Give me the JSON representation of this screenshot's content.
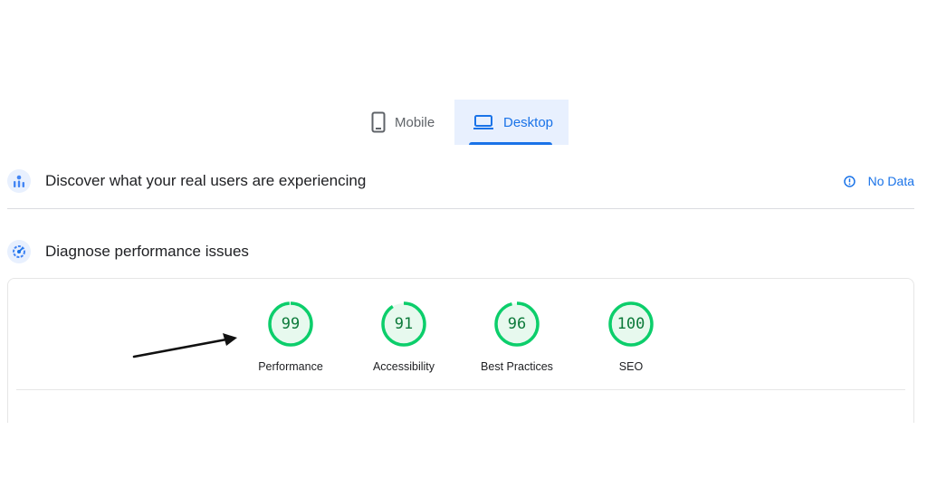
{
  "tabs": [
    {
      "label": "Mobile",
      "icon": "smartphone-icon",
      "selected": false
    },
    {
      "label": "Desktop",
      "icon": "laptop-icon",
      "selected": true
    }
  ],
  "crux": {
    "title": "Discover what your real users are experiencing",
    "status_label": "No Data",
    "status_icon": "info-icon"
  },
  "diagnose": {
    "title": "Diagnose performance issues"
  },
  "scores": [
    {
      "label": "Performance",
      "value": 99
    },
    {
      "label": "Accessibility",
      "value": 91
    },
    {
      "label": "Best Practices",
      "value": 96
    },
    {
      "label": "SEO",
      "value": 100
    }
  ],
  "colors": {
    "accent": "#1a73e8",
    "score_good": "#0cce6b",
    "score_good_bg": "#e7f9ee",
    "score_good_text": "#0c7a3a"
  }
}
